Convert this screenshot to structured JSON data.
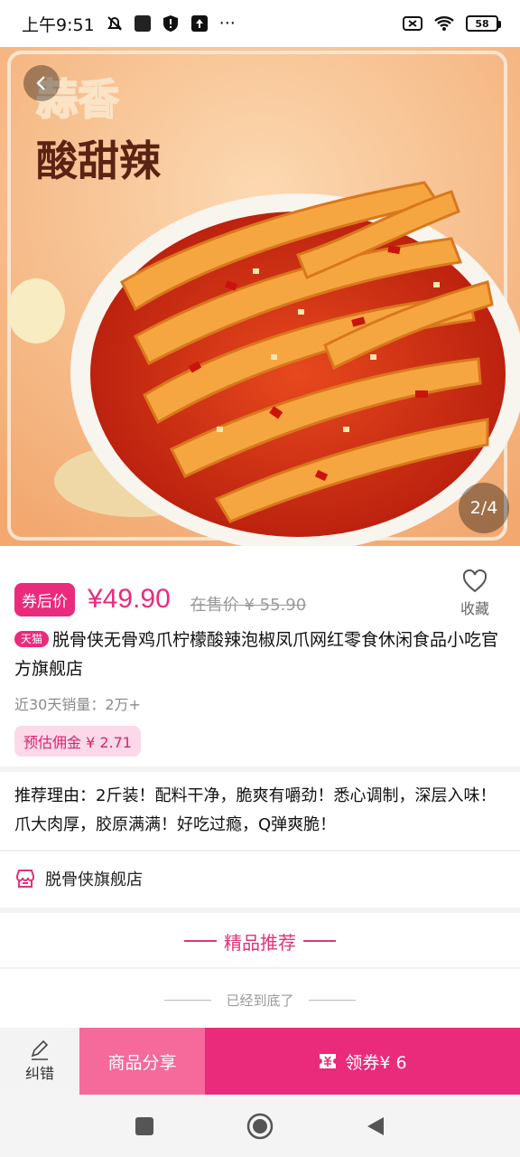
{
  "status_bar": {
    "time": "上午9:51",
    "battery": "58",
    "more": "···"
  },
  "hero": {
    "headline_1": "蒜香",
    "headline_2": "酸甜辣",
    "page_indicator": "2/4"
  },
  "price": {
    "coupon_label": "券后价",
    "current": "¥49.90",
    "original": "在售价 ¥ 55.90"
  },
  "favorite": {
    "label": "收藏"
  },
  "product": {
    "platform_tag": "天猫",
    "title": "脱骨侠无骨鸡爪柠檬酸辣泡椒凤爪网红零食休闲食品小吃官方旗舰店",
    "sales": "近30天销量：2万+",
    "commission": "预估佣金 ¥ 2.71"
  },
  "recommendation": {
    "text": "推荐理由：2斤装！配料干净，脆爽有嚼劲！悉心调制，深层入味！爪大肉厚，胶原满满！好吃过瘾，Q弹爽脆！"
  },
  "shop": {
    "name": "脱骨侠旗舰店"
  },
  "section": {
    "title": "精品推荐"
  },
  "end_text": "已经到底了",
  "actions": {
    "report": "纠错",
    "share": "商品分享",
    "coupon": "领券¥ 6"
  },
  "colors": {
    "accent": "#ea2a7b",
    "share_bg": "#f56a9b",
    "commission_bg": "#fbd9e8"
  },
  "icons": [
    "back-icon",
    "heart-icon",
    "store-icon",
    "pencil-icon",
    "coupon-icon",
    "nav-square-icon",
    "nav-home-icon",
    "nav-back-icon"
  ]
}
